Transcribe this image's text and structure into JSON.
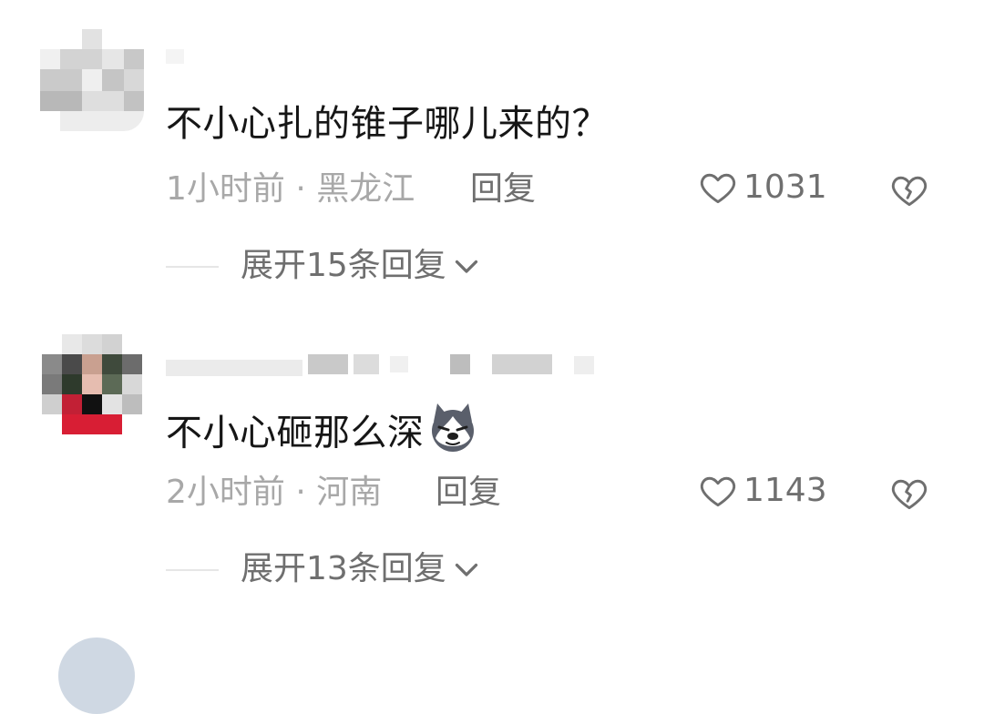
{
  "comments": [
    {
      "text": "不小心扎的锥子哪儿来的？",
      "meta": "1小时前 · 黑龙江",
      "reply_label": "回复",
      "likes": "1031",
      "expand_label": "展开15条回复"
    },
    {
      "text": "不小心砸那么深",
      "meta": "2小时前 · 河南",
      "reply_label": "回复",
      "likes": "1143",
      "expand_label": "展开13条回复"
    }
  ],
  "icons": {
    "like": "heart-outline-icon",
    "dislike": "broken-heart-icon",
    "expand": "chevron-down-icon",
    "emoji": "husky-dog-emoji-icon"
  }
}
